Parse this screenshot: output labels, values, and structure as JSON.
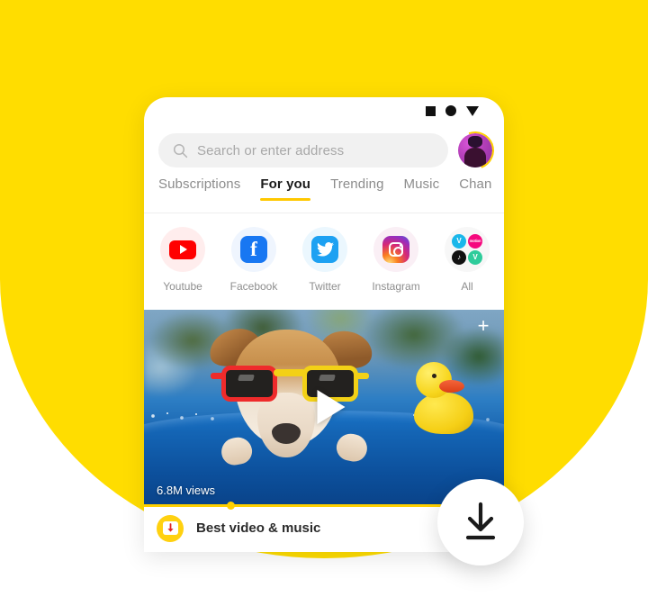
{
  "theme": {
    "brand_yellow": "#FFDD00",
    "accent_yellow": "#FFC800",
    "card_white": "#FFFFFF",
    "text_dark": "#1B1B1B",
    "text_muted": "#8E8E8E"
  },
  "status_bar": {
    "icons": [
      "square-icon",
      "circle-icon",
      "triangle-down-icon"
    ]
  },
  "search": {
    "placeholder": "Search or enter address",
    "icon": "search-icon",
    "value": ""
  },
  "account": {
    "avatar": "user-avatar",
    "ring": "progress-ring"
  },
  "tabs": [
    {
      "label": "Subscriptions",
      "active": false
    },
    {
      "label": "For you",
      "active": true
    },
    {
      "label": "Trending",
      "active": false
    },
    {
      "label": "Music",
      "active": false
    },
    {
      "label": "Chan",
      "active": false
    }
  ],
  "shortcuts": [
    {
      "label": "Youtube",
      "icon": "youtube-icon"
    },
    {
      "label": "Facebook",
      "icon": "facebook-icon"
    },
    {
      "label": "Twitter",
      "icon": "twitter-icon"
    },
    {
      "label": "Instagram",
      "icon": "instagram-icon"
    },
    {
      "label": "All",
      "icon": "all-apps-icon"
    }
  ],
  "all_cluster": [
    {
      "name": "vimeo-icon",
      "glyph": "V",
      "color": "#1AB7EA"
    },
    {
      "name": "dailymotion-icon",
      "glyph": "motion",
      "color": "#F5097E"
    },
    {
      "name": "tiktok-icon",
      "glyph": "♪",
      "color": "#111111"
    },
    {
      "name": "vine-icon",
      "glyph": "V",
      "color": "#2ECC9B"
    }
  ],
  "video": {
    "views": "6.8M views",
    "play_icon": "play-icon",
    "add_icon": "plus-icon",
    "thumbnail": "dog-with-sunglasses-in-pool"
  },
  "bottom_bar": {
    "badge_icon": "download-badge-icon",
    "title": "Best video & music",
    "progress_percent": 23
  },
  "fab": {
    "icon": "download-icon",
    "label": "Download"
  }
}
